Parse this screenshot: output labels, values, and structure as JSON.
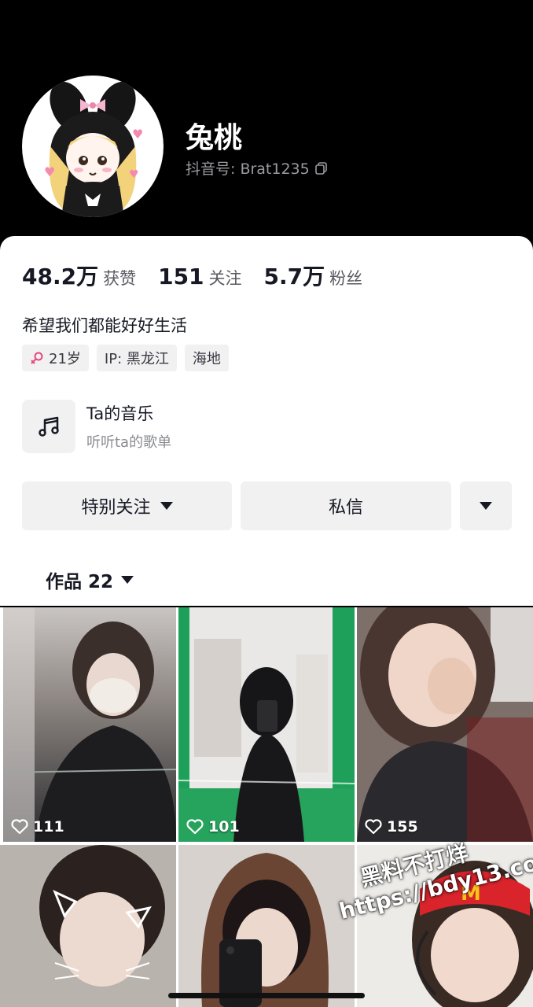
{
  "profile": {
    "nickname": "兔桃",
    "douyin_id": "抖音号: Brat1235"
  },
  "stats": {
    "likes_num": "48.2万",
    "likes_label": "获赞",
    "following_num": "151",
    "following_label": "关注",
    "followers_num": "5.7万",
    "followers_label": "粉丝"
  },
  "bio": "希望我们都能好好生活",
  "tags": {
    "age": "21岁",
    "ip": "IP: 黑龙江",
    "district": "海地"
  },
  "music": {
    "title": "Ta的音乐",
    "subtitle": "听听ta的歌单"
  },
  "actions": {
    "follow_label": "特别关注",
    "message_label": "私信"
  },
  "works": {
    "label": "作品 22"
  },
  "videos": [
    {
      "likes": "111"
    },
    {
      "likes": "101"
    },
    {
      "likes": "155"
    },
    {
      "likes": ""
    },
    {
      "likes": ""
    },
    {
      "likes": ""
    }
  ],
  "watermark": {
    "line1": "黑料不打烊",
    "line2": "https://bdy13.co"
  },
  "colors": {
    "accent_pink": "#e8477e",
    "text_primary": "#161823",
    "tag_bg": "#f1f1f2"
  }
}
